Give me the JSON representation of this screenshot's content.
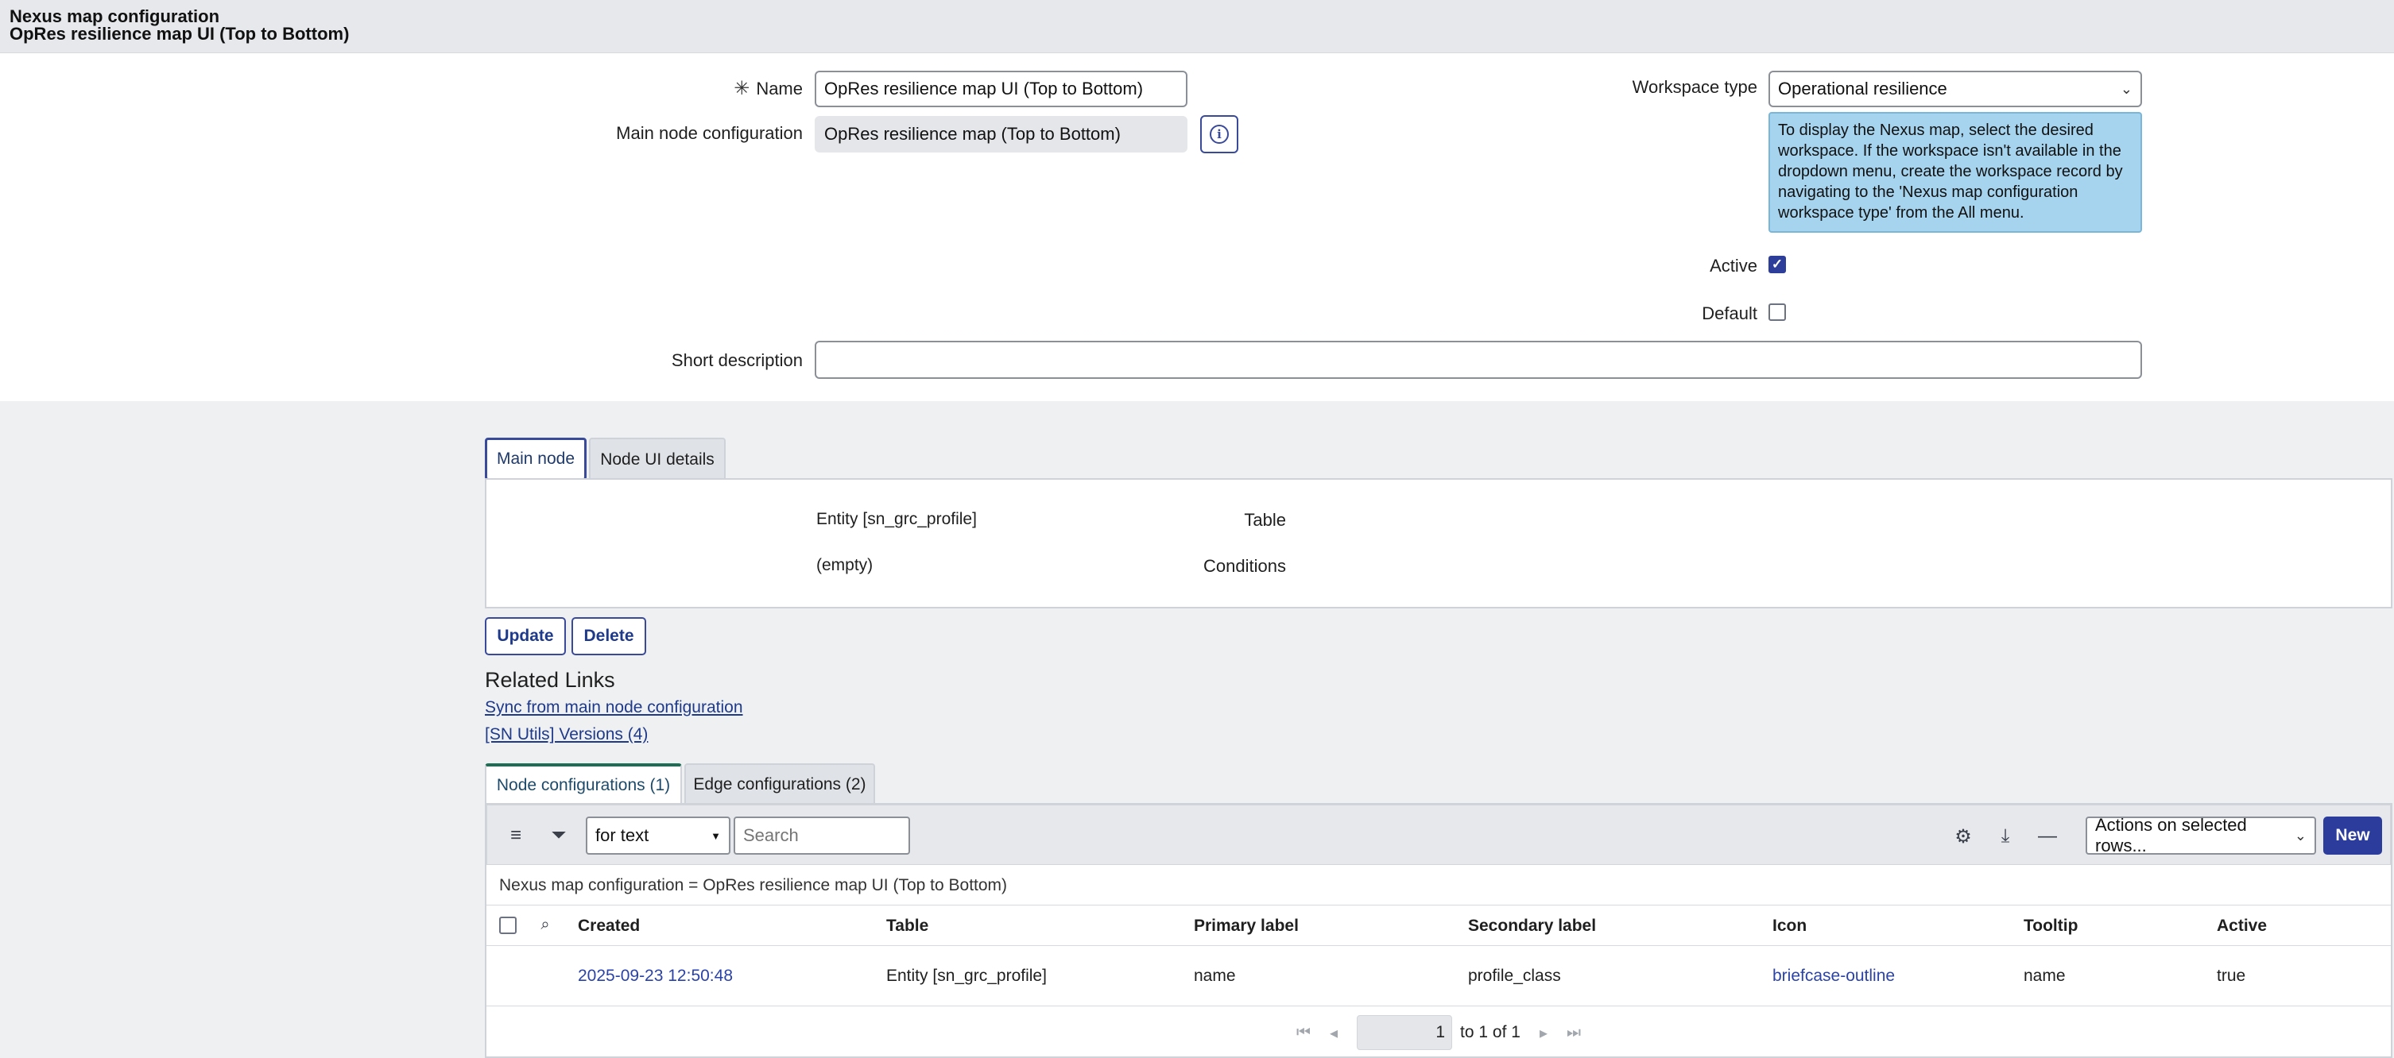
{
  "header": {
    "title": "Nexus map configuration",
    "subtitle": "OpRes resilience map UI (Top to Bottom)"
  },
  "form": {
    "required_marker": "✳",
    "name_label": "Name",
    "name_value": "OpRes resilience map UI (Top to Bottom)",
    "main_node_label": "Main node configuration",
    "main_node_value": "OpRes resilience map (Top to Bottom)",
    "info_icon": "info-icon",
    "workspace_label": "Workspace type",
    "workspace_value": "Operational resilience",
    "workspace_help": "To display the Nexus map, select the desired workspace. If the workspace isn't available in the dropdown menu, create the workspace record by navigating to the 'Nexus map configuration workspace type' from the All menu.",
    "active_label": "Active",
    "active_checked": true,
    "default_label": "Default",
    "default_checked": false,
    "short_desc_label": "Short description",
    "short_desc_value": ""
  },
  "tabs": [
    {
      "label": "Main node",
      "active": true
    },
    {
      "label": "Node UI details",
      "active": false
    }
  ],
  "main_node": {
    "table_label": "Table",
    "table_value": "Entity [sn_grc_profile]",
    "conditions_label": "Conditions",
    "conditions_value": "(empty)"
  },
  "actions": {
    "update": "Update",
    "delete": "Delete"
  },
  "related_links": {
    "title": "Related Links",
    "items": [
      "Sync from main node configuration",
      "[SN Utils] Versions (4)"
    ]
  },
  "list_tabs": [
    {
      "label": "Node configurations (1)",
      "active": true
    },
    {
      "label": "Edge configurations (2)",
      "active": false
    }
  ],
  "list": {
    "search_field": "for text",
    "search_placeholder": "Search",
    "actions_select": "Actions on selected rows...",
    "new_button": "New",
    "filter_condition": "Nexus map configuration = OpRes resilience map UI (Top to Bottom)",
    "columns": [
      "Created",
      "Table",
      "Primary label",
      "Secondary label",
      "Icon",
      "Tooltip",
      "Active"
    ],
    "rows": [
      {
        "created": "2025-09-23 12:50:48",
        "table": "Entity [sn_grc_profile]",
        "primary_label": "name",
        "secondary_label": "profile_class",
        "icon": "briefcase-outline",
        "tooltip": "name",
        "active": "true"
      }
    ],
    "pager": {
      "page": "1",
      "range": "to 1 of 1"
    }
  }
}
